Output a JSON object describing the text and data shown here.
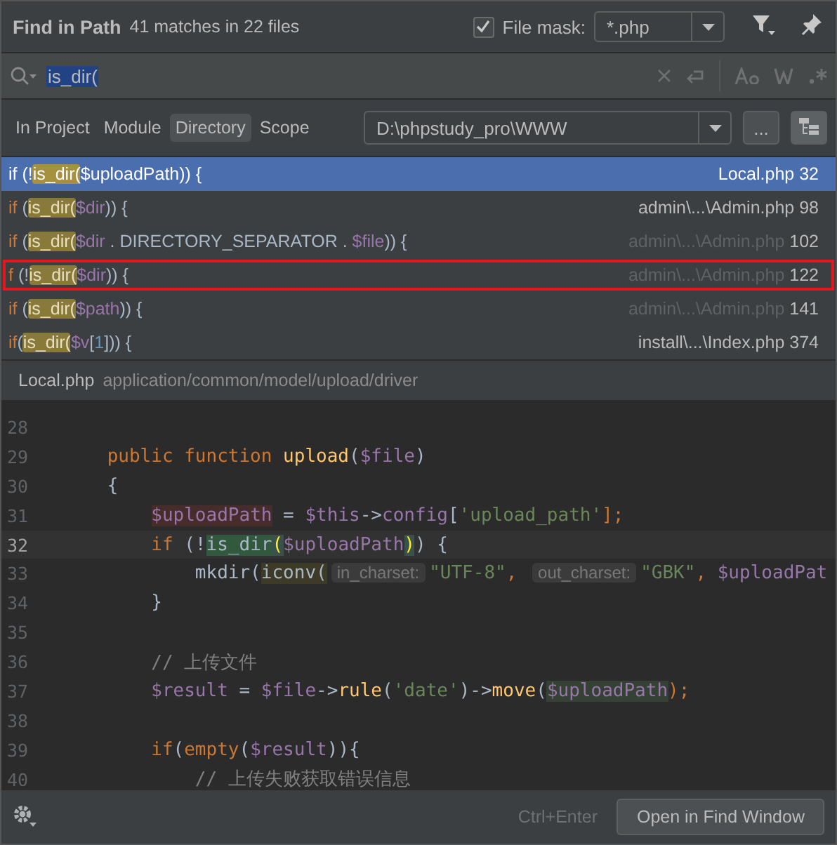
{
  "title": "Find in Path",
  "summary": "41 matches in 22 files",
  "file_mask": {
    "checked": true,
    "label": "File mask:",
    "value": "*.php"
  },
  "search": {
    "value": "is_dir("
  },
  "scopes": [
    {
      "label": "In Project",
      "selected": false
    },
    {
      "label": "Module",
      "selected": false
    },
    {
      "label": "Directory",
      "selected": true
    },
    {
      "label": "Scope",
      "selected": false
    }
  ],
  "directory": "D:\\phpstudy_pro\\WWW",
  "browse_label": "...",
  "results": [
    {
      "selected": true,
      "outlined": false,
      "dimmed": false,
      "file": "Local.php",
      "line": "32",
      "code": [
        {
          "kind": "kw",
          "text": "if "
        },
        {
          "kind": "plain",
          "text": "(!"
        },
        {
          "kind": "match",
          "text": "is_dir("
        },
        {
          "kind": "var",
          "text": "$uploadPath"
        },
        {
          "kind": "plain",
          "text": ")) {"
        }
      ]
    },
    {
      "selected": false,
      "outlined": false,
      "dimmed": false,
      "file": "admin\\...\\Admin.php",
      "line": "98",
      "code": [
        {
          "kind": "kw",
          "text": "if "
        },
        {
          "kind": "plain",
          "text": "("
        },
        {
          "kind": "match",
          "text": "is_dir("
        },
        {
          "kind": "var",
          "text": "$dir"
        },
        {
          "kind": "plain",
          "text": ")) {"
        }
      ]
    },
    {
      "selected": false,
      "outlined": false,
      "dimmed": true,
      "file": "admin\\...\\Admin.php",
      "line": "102",
      "code": [
        {
          "kind": "kw",
          "text": "if "
        },
        {
          "kind": "plain",
          "text": "("
        },
        {
          "kind": "match",
          "text": "is_dir("
        },
        {
          "kind": "var",
          "text": "$dir"
        },
        {
          "kind": "plain",
          "text": " . DIRECTORY_SEPARATOR . "
        },
        {
          "kind": "var",
          "text": "$file"
        },
        {
          "kind": "plain",
          "text": ")) {"
        }
      ]
    },
    {
      "selected": false,
      "outlined": true,
      "dimmed": true,
      "file": "admin\\...\\Admin.php",
      "line": "122",
      "code": [
        {
          "kind": "kw",
          "text": "f "
        },
        {
          "kind": "plain",
          "text": "(!"
        },
        {
          "kind": "match",
          "text": "is_dir("
        },
        {
          "kind": "var",
          "text": "$dir"
        },
        {
          "kind": "plain",
          "text": ")) {"
        }
      ]
    },
    {
      "selected": false,
      "outlined": false,
      "dimmed": true,
      "file": "admin\\...\\Admin.php",
      "line": "141",
      "code": [
        {
          "kind": "kw",
          "text": "if "
        },
        {
          "kind": "plain",
          "text": "("
        },
        {
          "kind": "match",
          "text": "is_dir("
        },
        {
          "kind": "var",
          "text": "$path"
        },
        {
          "kind": "plain",
          "text": ")) {"
        }
      ]
    },
    {
      "selected": false,
      "outlined": false,
      "dimmed": false,
      "file": "install\\...\\Index.php",
      "line": "374",
      "code": [
        {
          "kind": "kw",
          "text": "if"
        },
        {
          "kind": "plain",
          "text": "("
        },
        {
          "kind": "match",
          "text": "is_dir("
        },
        {
          "kind": "var",
          "text": "$v"
        },
        {
          "kind": "plain",
          "text": "["
        },
        {
          "kind": "num",
          "text": "1"
        },
        {
          "kind": "plain",
          "text": "])) {"
        }
      ]
    }
  ],
  "preview": {
    "file": "Local.php",
    "path": "application/common/model/upload/driver"
  },
  "editor": [
    {
      "number": "28",
      "current": false
    },
    {
      "number": "29",
      "current": false,
      "code": [
        {
          "kind": "kw",
          "text": "    public function "
        },
        {
          "kind": "fn",
          "text": "upload"
        },
        {
          "kind": "plain",
          "text": "("
        },
        {
          "kind": "var",
          "text": "$file"
        },
        {
          "kind": "plain",
          "text": ")"
        }
      ]
    },
    {
      "number": "30",
      "current": false,
      "code": [
        {
          "kind": "plain",
          "text": "    {"
        }
      ]
    },
    {
      "number": "31",
      "current": false,
      "code": [
        {
          "kind": "var-mark",
          "text": "        $uploadPath"
        },
        {
          "kind": "plain",
          "text": " = "
        },
        {
          "kind": "var",
          "text": "$this"
        },
        {
          "kind": "plain",
          "text": "->"
        },
        {
          "kind": "var",
          "text": "config"
        },
        {
          "kind": "plain",
          "text": "["
        },
        {
          "kind": "str",
          "text": "'upload_path'"
        },
        {
          "kind": "kw",
          "text": "];"
        }
      ]
    },
    {
      "number": "32",
      "current": true,
      "code": [
        {
          "kind": "kw",
          "text": "        if "
        },
        {
          "kind": "plain",
          "text": "(!"
        },
        {
          "kind": "match",
          "text": "is_dir"
        },
        {
          "kind": "paren",
          "text": "("
        },
        {
          "kind": "var",
          "text": "$uploadPath"
        },
        {
          "kind": "paren",
          "text": ")"
        },
        {
          "kind": "plain",
          "text": ") {"
        }
      ]
    },
    {
      "number": "33",
      "current": false,
      "code": [
        {
          "kind": "plain",
          "text": "            mkdir("
        },
        {
          "kind": "call",
          "text": "iconv("
        },
        {
          "kind": "hint",
          "text": "in_charset:"
        },
        {
          "kind": "str",
          "text": "\"UTF-8\""
        },
        {
          "kind": "kw",
          "text": ", "
        },
        {
          "kind": "hint",
          "text": "out_charset:"
        },
        {
          "kind": "str",
          "text": "\"GBK\""
        },
        {
          "kind": "kw",
          "text": ", "
        },
        {
          "kind": "var",
          "text": "$uploadPat"
        }
      ]
    },
    {
      "number": "34",
      "current": false,
      "code": [
        {
          "kind": "plain",
          "text": "        }"
        }
      ]
    },
    {
      "number": "35",
      "current": false
    },
    {
      "number": "36",
      "current": false,
      "code": [
        {
          "kind": "comment",
          "text": "        // 上传文件"
        }
      ]
    },
    {
      "number": "37",
      "current": false,
      "code": [
        {
          "kind": "var",
          "text": "        $result"
        },
        {
          "kind": "plain",
          "text": " = "
        },
        {
          "kind": "var",
          "text": "$file"
        },
        {
          "kind": "plain",
          "text": "->"
        },
        {
          "kind": "fn",
          "text": "rule"
        },
        {
          "kind": "plain",
          "text": "("
        },
        {
          "kind": "str",
          "text": "'date'"
        },
        {
          "kind": "plain",
          "text": ")->"
        },
        {
          "kind": "fn",
          "text": "move"
        },
        {
          "kind": "plain",
          "text": "("
        },
        {
          "kind": "var-mark2",
          "text": "$uploadPath"
        },
        {
          "kind": "kw",
          "text": ");"
        }
      ]
    },
    {
      "number": "38",
      "current": false
    },
    {
      "number": "39",
      "current": false,
      "code": [
        {
          "kind": "kw",
          "text": "        if"
        },
        {
          "kind": "plain",
          "text": "("
        },
        {
          "kind": "kw",
          "text": "empty"
        },
        {
          "kind": "plain",
          "text": "("
        },
        {
          "kind": "var",
          "text": "$result"
        },
        {
          "kind": "plain",
          "text": ")){"
        }
      ]
    },
    {
      "number": "40",
      "current": false,
      "code": [
        {
          "kind": "comment",
          "text": "            // 上传失败获取错误信息"
        }
      ]
    }
  ],
  "shortcut": "Ctrl+Enter",
  "open_button": "Open in Find Window"
}
